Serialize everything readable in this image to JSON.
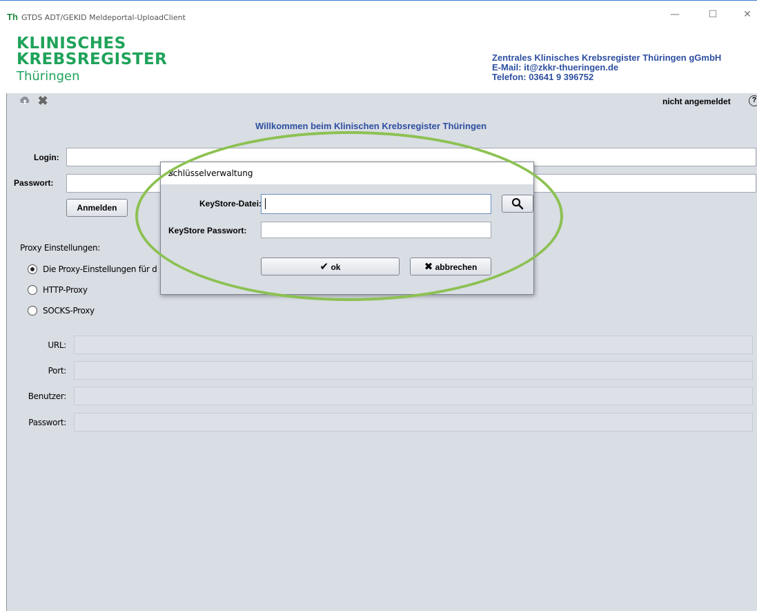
{
  "window": {
    "app_icon": "Th",
    "title": "GTDS ADT/GEKID Meldeportal-UploadClient",
    "minimize_icon": "—",
    "maximize_icon": "☐",
    "close_icon": "✕"
  },
  "header": {
    "logo_line1": "KLINISCHES",
    "logo_line2": "KREBSREGISTER",
    "logo_line3": "Thüringen",
    "org_name": "Zentrales Klinisches Krebsregister Thüringen gGmbH",
    "email": "E-Mail:   it@zkkr-thueringen.de",
    "phone": "Telefon: 03641 9 396752"
  },
  "toolbar": {
    "status": "nicht angemeldet",
    "help_icon": "?"
  },
  "main": {
    "welcome": "Willkommen beim Klinischen Krebsregister Thüringen",
    "login_label": "Login:",
    "password_label": "Passwort:",
    "login_button": "Anmelden",
    "proxy_title": "Proxy Einstellungen:",
    "proxy_options": [
      "Die Proxy-Einstellungen für d",
      "HTTP-Proxy",
      "SOCKS-Proxy"
    ],
    "proxy_selected": 0,
    "proxy_fields": [
      "URL:",
      "Port:",
      "Benutzer:",
      "Passwort:"
    ]
  },
  "dialog": {
    "title": "Schlüsselverwaltung",
    "close": "✕",
    "keystore_file_label": "KeyStore-Datei:",
    "keystore_password_label": "KeyStore Passwort:",
    "ok_label": "ok",
    "cancel_label": "abbrechen"
  },
  "colors": {
    "brand_green": "#1fa35a",
    "accent_blue": "#2d4fa0",
    "highlight_ellipse": "#8cc152"
  }
}
